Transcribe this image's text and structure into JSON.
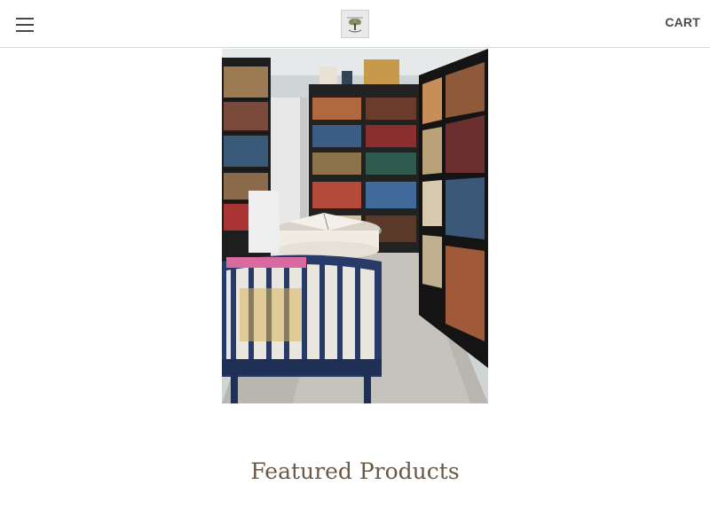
{
  "header": {
    "menu_icon": "hamburger-menu-icon",
    "logo_icon": "tree-logo-icon",
    "cart_label": "CART"
  },
  "hero": {
    "image_description": "bookstore-interior-photo"
  },
  "featured": {
    "title": "Featured Products"
  },
  "colors": {
    "heading": "#6b5846",
    "cart_text": "#4b4b4b",
    "divider": "#d9d9d9"
  }
}
